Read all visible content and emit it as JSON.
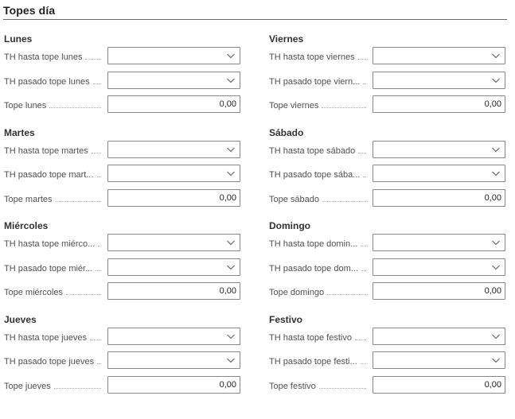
{
  "section": {
    "title": "Topes día"
  },
  "left": [
    {
      "title": "Lunes",
      "rows": [
        {
          "label": "TH hasta tope lunes",
          "value": ""
        },
        {
          "label": "TH pasado tope lunes",
          "value": ""
        },
        {
          "label": "Tope lunes",
          "value": "0,00"
        }
      ]
    },
    {
      "title": "Martes",
      "rows": [
        {
          "label": "TH hasta tope martes",
          "value": ""
        },
        {
          "label": "TH pasado tope mart...",
          "value": ""
        },
        {
          "label": "Tope martes",
          "value": "0,00"
        }
      ]
    },
    {
      "title": "Miércoles",
      "rows": [
        {
          "label": "TH hasta tope miérco...",
          "value": ""
        },
        {
          "label": "TH pasado tope miér...",
          "value": ""
        },
        {
          "label": "Tope miércoles",
          "value": "0,00"
        }
      ]
    },
    {
      "title": "Jueves",
      "rows": [
        {
          "label": "TH hasta tope jueves",
          "value": ""
        },
        {
          "label": "TH pasado tope jueves",
          "value": ""
        },
        {
          "label": "Tope jueves",
          "value": "0,00"
        }
      ]
    }
  ],
  "right": [
    {
      "title": "Viernes",
      "rows": [
        {
          "label": "TH hasta tope viernes",
          "value": ""
        },
        {
          "label": "TH pasado tope viern...",
          "value": ""
        },
        {
          "label": "Tope viernes",
          "value": "0,00"
        }
      ]
    },
    {
      "title": "Sábado",
      "rows": [
        {
          "label": "TH hasta tope sábado",
          "value": ""
        },
        {
          "label": "TH pasado tope sába...",
          "value": ""
        },
        {
          "label": "Tope sábado",
          "value": "0,00"
        }
      ]
    },
    {
      "title": "Domingo",
      "rows": [
        {
          "label": "TH hasta tope domin...",
          "value": ""
        },
        {
          "label": "TH pasado tope dom...",
          "value": ""
        },
        {
          "label": "Tope domingo",
          "value": "0,00"
        }
      ]
    },
    {
      "title": "Festivo",
      "rows": [
        {
          "label": "TH hasta tope festivo",
          "value": ""
        },
        {
          "label": "TH pasado tope festi...",
          "value": ""
        },
        {
          "label": "Tope festivo",
          "value": "0,00"
        }
      ]
    }
  ],
  "icons": {
    "dropdown": "chevron-down-icon"
  },
  "colors": {
    "border": "#8a8886",
    "text": "#323130",
    "label": "#505050"
  }
}
